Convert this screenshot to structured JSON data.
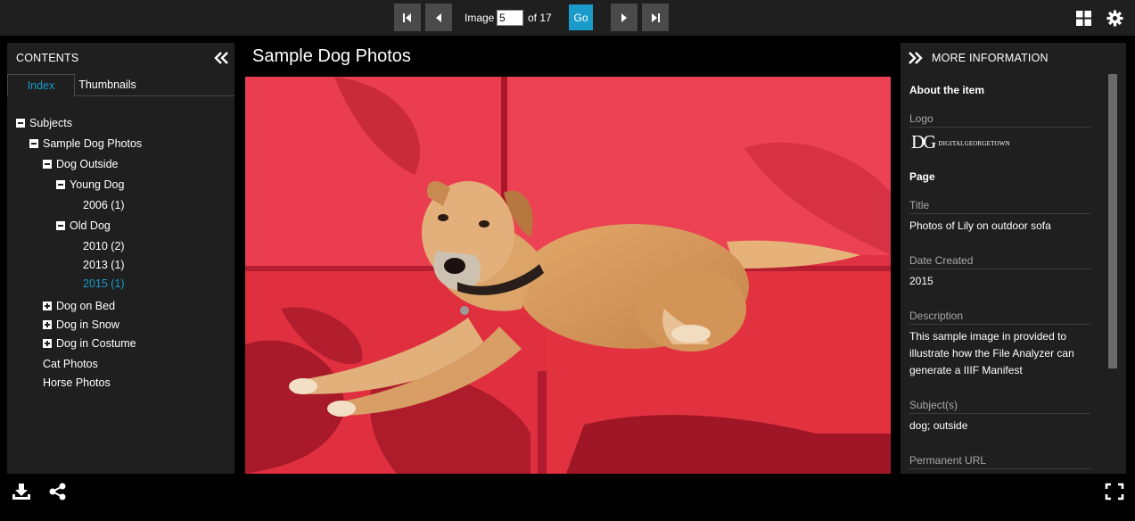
{
  "toolbar": {
    "image_label": "Image",
    "page_value": "5",
    "of_label": "of 17",
    "go_label": "Go",
    "first_icon": "first-page-icon",
    "prev_icon": "previous-page-icon",
    "next_icon": "next-page-icon",
    "last_icon": "last-page-icon",
    "gallery_icon": "grid-icon",
    "settings_icon": "gear-icon"
  },
  "contents": {
    "title": "CONTENTS",
    "tabs": [
      {
        "label": "Index"
      },
      {
        "label": "Thumbnails"
      }
    ],
    "tree": [
      {
        "label": "Subjects",
        "toggle": "minus"
      },
      {
        "label": "Sample Dog Photos",
        "toggle": "minus"
      },
      {
        "label": "Dog Outside",
        "toggle": "minus"
      },
      {
        "label": "Young Dog",
        "toggle": "minus"
      },
      {
        "label": "2006 (1)"
      },
      {
        "label": "Old Dog",
        "toggle": "minus"
      },
      {
        "label": "2010 (2)"
      },
      {
        "label": "2013 (1)"
      },
      {
        "label": "2015 (1)",
        "selected": true
      },
      {
        "label": "Dog on Bed",
        "toggle": "plus"
      },
      {
        "label": "Dog in Snow",
        "toggle": "plus"
      },
      {
        "label": "Dog in Costume",
        "toggle": "plus"
      },
      {
        "label": "Cat Photos"
      },
      {
        "label": "Horse Photos"
      }
    ]
  },
  "main": {
    "title": "Sample Dog Photos"
  },
  "more_info": {
    "title": "MORE INFORMATION",
    "about_heading": "About the item",
    "logo_label": "Logo",
    "logo_mark": "DG",
    "logo_text": "DIGITALGEORGETOWN",
    "page_heading": "Page",
    "fields": [
      {
        "label": "Title",
        "value": "Photos of Lily on outdoor sofa"
      },
      {
        "label": "Date Created",
        "value": "2015"
      },
      {
        "label": "Description",
        "value": "This sample image in provided to illustrate how the File Analyzer can generate a IIIF Manifest"
      },
      {
        "label": "Subject(s)",
        "value": "dog; outside"
      },
      {
        "label": "Permanent URL",
        "value": ""
      }
    ]
  },
  "footer": {
    "download_icon": "download-icon",
    "share_icon": "share-icon",
    "fullscreen_icon": "fullscreen-icon"
  },
  "colors": {
    "accent": "#1a9bc9",
    "panel": "#1f1f1f",
    "button": "#4a4a4a"
  }
}
